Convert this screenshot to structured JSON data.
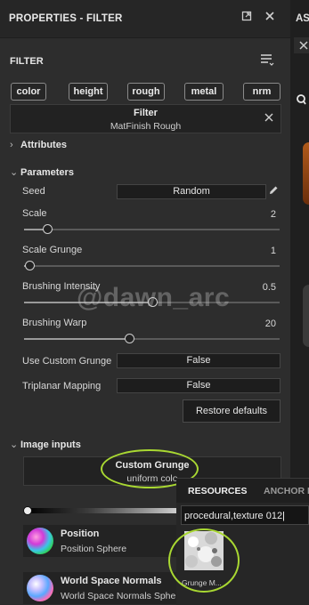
{
  "panel": {
    "title": "PROPERTIES - FILTER",
    "header_icons": [
      "float-window-icon",
      "close-icon"
    ]
  },
  "right_tab": {
    "title": "AS"
  },
  "filter_section": {
    "title": "FILTER",
    "menu_icon": "hamburger-menu-icon",
    "tags": [
      "color",
      "height",
      "rough",
      "metal",
      "nrm"
    ],
    "filter_label": "Filter",
    "filter_name": "MatFinish Rough"
  },
  "attributes": {
    "title": "Attributes",
    "expanded": false
  },
  "parameters": {
    "title": "Parameters",
    "expanded": true,
    "seed": {
      "label": "Seed",
      "value": "Random"
    },
    "scale": {
      "label": "Scale",
      "value": "2",
      "fraction": 0.09
    },
    "scale_grunge": {
      "label": "Scale Grunge",
      "value": "1",
      "fraction": 0.02
    },
    "brushing_intensity": {
      "label": "Brushing Intensity",
      "value": "0.5",
      "fraction": 0.5
    },
    "brushing_warp": {
      "label": "Brushing Warp",
      "value": "20",
      "fraction": 0.41
    },
    "use_custom_grunge": {
      "label": "Use Custom Grunge",
      "value": "False"
    },
    "triplanar_mapping": {
      "label": "Triplanar Mapping",
      "value": "False"
    },
    "restore_label": "Restore defaults"
  },
  "watermark": "@dawn_arc",
  "image_inputs": {
    "title": "Image inputs",
    "expanded": true,
    "custom_grunge": {
      "label": "Custom Grunge",
      "sub": "uniform colo"
    },
    "inputs": [
      {
        "name": "Position",
        "sub": "Position Sphere"
      },
      {
        "name": "World Space Normals",
        "sub": "World Space Normals Sphe"
      }
    ]
  },
  "resources_popup": {
    "tabs": [
      "RESOURCES",
      "ANCHOR P"
    ],
    "search_value": "procedural,texture 012",
    "result_label": "Grunge M..."
  },
  "colors": {
    "accent_highlight": "#a9d832",
    "panel_bg": "#2d2d2d",
    "header_bg": "#262626"
  }
}
